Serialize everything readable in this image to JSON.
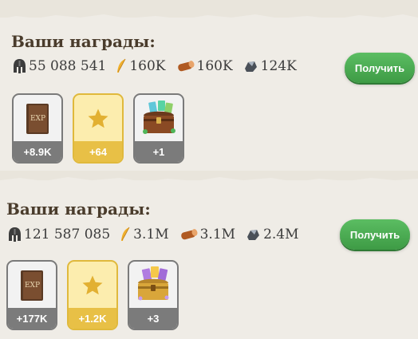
{
  "colors": {
    "button": "#4eaf55",
    "gold_card": "#fcedae",
    "gold_bar": "#e8c046",
    "grey_bar": "#7b7b7b"
  },
  "panels": [
    {
      "title": "Ваши награды:",
      "stats": [
        {
          "icon": "helmet-icon",
          "value": "55 088 541"
        },
        {
          "icon": "feather-icon",
          "value": "160K"
        },
        {
          "icon": "log-icon",
          "value": "160K"
        },
        {
          "icon": "stone-icon",
          "value": "124K"
        }
      ],
      "button": "Получить",
      "rewards": [
        {
          "icon": "exp-book-icon",
          "book_text": "EXP",
          "count": "+8.9K"
        },
        {
          "icon": "star-icon",
          "count": "+64"
        },
        {
          "icon": "chest-icon",
          "count": "+1"
        }
      ]
    },
    {
      "title": "Ваши награды:",
      "stats": [
        {
          "icon": "helmet-icon",
          "value": "121 587 085"
        },
        {
          "icon": "feather-icon",
          "value": "3.1M"
        },
        {
          "icon": "log-icon",
          "value": "3.1M"
        },
        {
          "icon": "stone-icon",
          "value": "2.4M"
        }
      ],
      "button": "Получить",
      "rewards": [
        {
          "icon": "exp-book-icon",
          "book_text": "EXP",
          "count": "+177K"
        },
        {
          "icon": "star-icon",
          "count": "+1.2K"
        },
        {
          "icon": "gold-chest-icon",
          "count": "+3"
        }
      ]
    }
  ]
}
